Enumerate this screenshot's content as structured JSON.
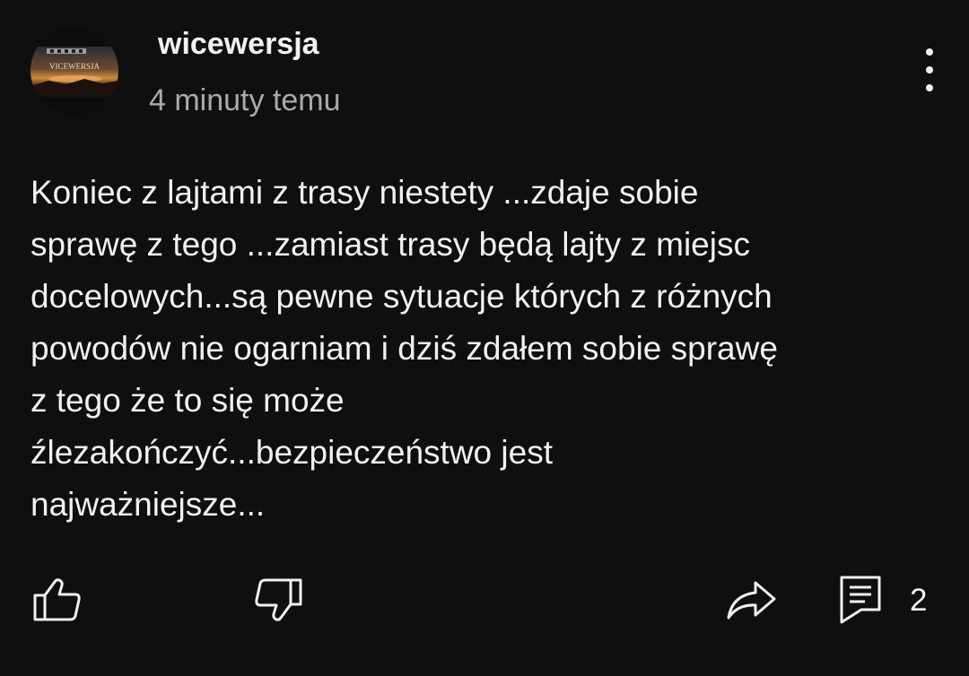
{
  "post": {
    "author": "wicewersja",
    "timestamp": "4 minuty temu",
    "avatar_text": "VICEWERSJA",
    "text": "Koniec z lajtami z trasy niestety ...zdaje sobie\nsprawę z tego ...zamiast trasy będą lajty z miejsc\ndocelowych...są pewne sytuacje których z różnych\npowodów nie ogarniam i dziś zdałem sobie sprawę\nz tego że to się może\nźlezakończyć...bezpieczeństwo jest\nnajważniejsze..."
  },
  "actions": {
    "like_icon": "thumbs-up-icon",
    "dislike_icon": "thumbs-down-icon",
    "share_icon": "share-arrow-icon",
    "comments_icon": "comment-icon",
    "comment_count": "2",
    "menu_icon": "more-vertical-icon"
  },
  "colors": {
    "background": "#0f0f0f",
    "text_primary": "#f1f1f1",
    "text_secondary": "#aaaaaa"
  }
}
